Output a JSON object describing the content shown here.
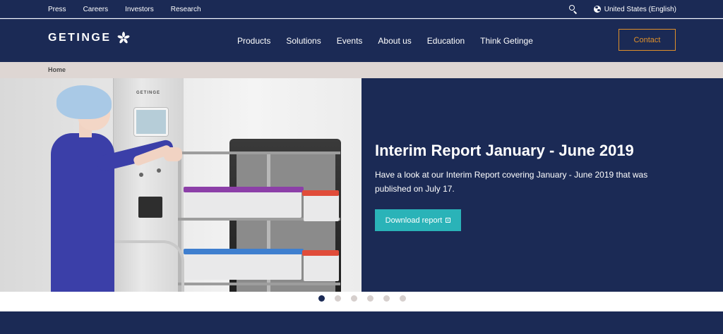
{
  "topbar": {
    "links": [
      "Press",
      "Careers",
      "Investors",
      "Research"
    ],
    "search_icon": "search-icon",
    "language_icon": "globe-icon",
    "language": "United States (English)"
  },
  "header": {
    "logo_text": "GETINGE",
    "logo_icon": "getinge-star-icon",
    "nav": [
      "Products",
      "Solutions",
      "Events",
      "About us",
      "Education",
      "Think Getinge"
    ],
    "contact_label": "Contact",
    "accent_color": "#e0902a",
    "background_color": "#1b2a55"
  },
  "breadcrumb": {
    "home": "Home"
  },
  "hero": {
    "machine_brand": "GETINGE",
    "title": "Interim Report January - June 2019",
    "text": "Have a look at our Interim Report covering January - June 2019 that was published on July 17.",
    "button_label": "Download report",
    "button_icon": "download-icon",
    "button_color": "#2ab3b8"
  },
  "carousel": {
    "slides": 6,
    "active": 1
  }
}
